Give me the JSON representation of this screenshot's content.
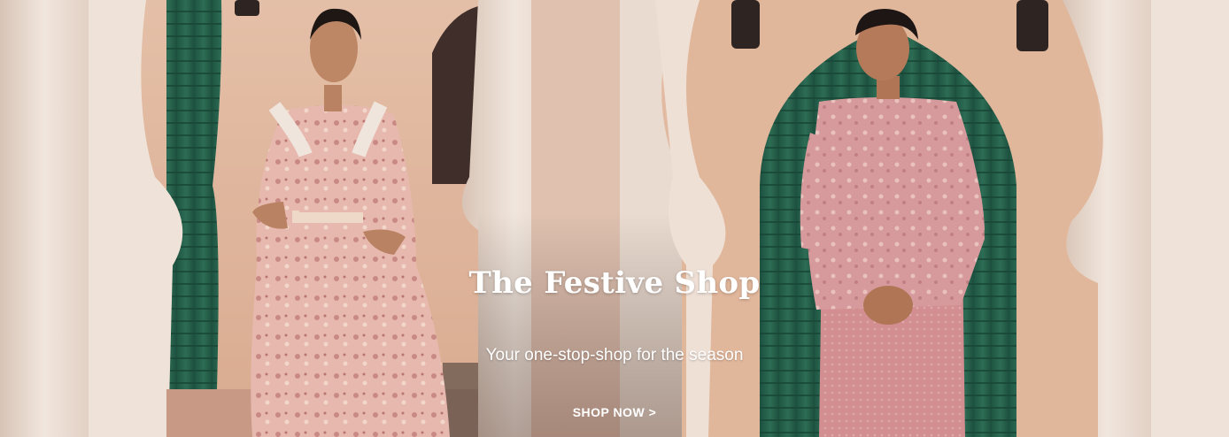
{
  "banner": {
    "title": "The Festive Shop",
    "subtitle": "Your one-stop-shop for the season",
    "cta_label": "SHOP NOW >"
  },
  "colors": {
    "wall": "#e6c6b0",
    "pillar": "#efe2d8",
    "door_green": "#245f4a",
    "outfit_pink": "#d9999a",
    "outfit_light": "#e8c2b8",
    "text": "#ffffff"
  }
}
